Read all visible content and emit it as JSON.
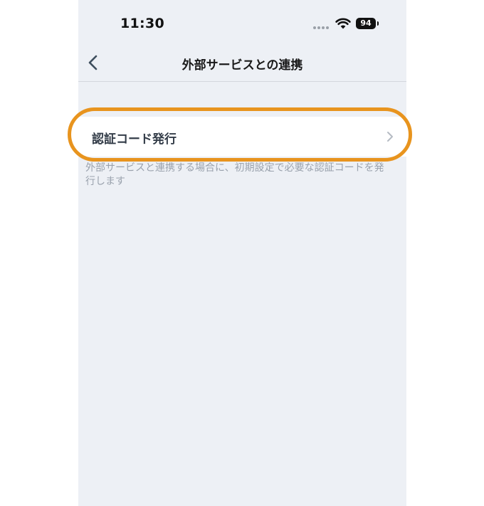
{
  "status_bar": {
    "time": "11:30",
    "battery": "94",
    "wifi_icon": "wifi-icon",
    "signal_icon": "signal-dots-icon"
  },
  "nav": {
    "back_icon": "chevron-left-icon",
    "title": "外部サービスとの連携"
  },
  "list": {
    "items": [
      {
        "label": "認証コード発行",
        "icon": "chevron-right-icon"
      }
    ],
    "footnote": "外部サービスと連携する場合に、初期設定で必要な認証コードを発行します"
  },
  "colors": {
    "background": "#edf0f5",
    "cell_background": "#ffffff",
    "highlight": "#e8941e",
    "title_text": "#1a1a1a",
    "label_text": "#333c48",
    "footnote_text": "#9aa2ad"
  }
}
